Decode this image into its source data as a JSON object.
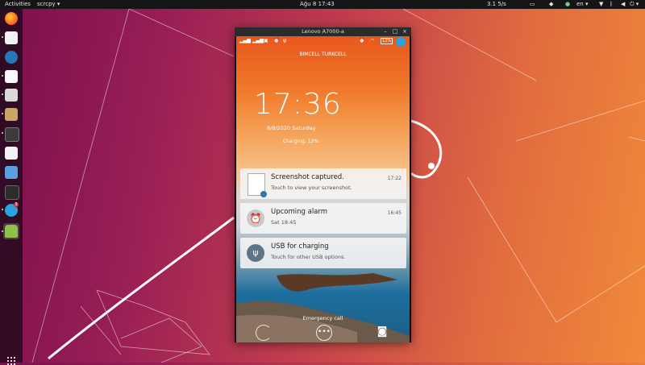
{
  "topbar": {
    "activities": "Activities",
    "app_name": "scrcpy",
    "clock": "Ağu 8  17:43",
    "network_speed": "3.1 5/s",
    "lang": "en"
  },
  "window": {
    "title": "Lenovo A7000-a",
    "minimize": "–",
    "maximize": "□",
    "close": "×"
  },
  "phone": {
    "battery": "12%",
    "carriers": "BIMCELL   TURKCELL",
    "time": "17:36",
    "date": "8/8/2020  Saturday",
    "charging": "Charging, 12%",
    "notifications": [
      {
        "title": "Screenshot captured.",
        "subtitle": "Touch to view your screenshot.",
        "time": "17:22",
        "icon": "screenshot-thumbnail-icon"
      },
      {
        "title": "Upcoming alarm",
        "subtitle": "Sat 18:45",
        "time": "16:45",
        "icon": "alarm-clock-icon"
      },
      {
        "title": "USB for charging",
        "subtitle": "Touch for other USB options.",
        "time": "",
        "icon": "usb-icon"
      }
    ],
    "emergency": "Emergency call"
  },
  "dock": {
    "badge_count": "3",
    "icons": [
      "firefox-icon",
      "typora-icon",
      "wordpress-icon",
      "text-editor-icon",
      "files-icon",
      "archive-icon",
      "terminal-icon",
      "screenshot-tool-icon",
      "calculator-icon",
      "system-monitor-icon",
      "telegram-icon",
      "android-icon"
    ]
  },
  "colors": {
    "accent_orange": "#e8571c",
    "topbar_bg": "#151515"
  }
}
